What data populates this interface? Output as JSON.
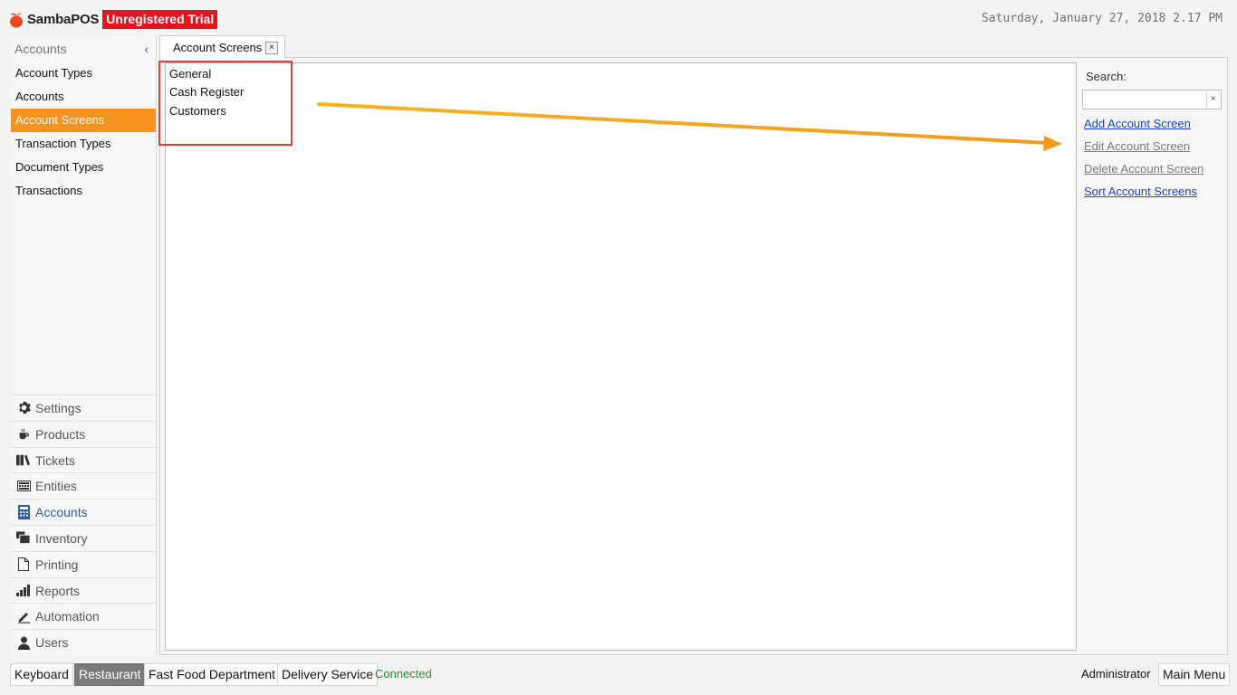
{
  "app": {
    "name": "SambaPOS",
    "trial_badge": "Unregistered Trial",
    "datetime": "Saturday, January 27, 2018 2.17 PM"
  },
  "sidebar": {
    "title": "Accounts",
    "collapse_glyph": "‹",
    "items": [
      {
        "label": "Account Types"
      },
      {
        "label": "Accounts"
      },
      {
        "label": "Account Screens"
      },
      {
        "label": "Transaction Types"
      },
      {
        "label": "Document Types"
      },
      {
        "label": "Transactions"
      }
    ],
    "active_item": "Account Screens"
  },
  "modules": [
    {
      "label": "Settings",
      "icon": "gear-icon"
    },
    {
      "label": "Products",
      "icon": "coffee-cup-icon"
    },
    {
      "label": "Tickets",
      "icon": "tickets-icon"
    },
    {
      "label": "Entities",
      "icon": "keyboard-icon"
    },
    {
      "label": "Accounts",
      "icon": "calculator-icon"
    },
    {
      "label": "Inventory",
      "icon": "inventory-icon"
    },
    {
      "label": "Printing",
      "icon": "document-icon"
    },
    {
      "label": "Reports",
      "icon": "bar-chart-icon"
    },
    {
      "label": "Automation",
      "icon": "pen-icon"
    },
    {
      "label": "Users",
      "icon": "user-icon"
    }
  ],
  "tab": {
    "label": "Account Screens",
    "close_glyph": "×"
  },
  "list": {
    "items": [
      {
        "label": "General"
      },
      {
        "label": "Cash Register"
      },
      {
        "label": "Customers"
      }
    ]
  },
  "right_panel": {
    "search_label": "Search:",
    "search_value": "",
    "clear_glyph": "×",
    "actions": [
      {
        "label": "Add Account Screen",
        "enabled": true
      },
      {
        "label": "Edit Account Screen",
        "enabled": false
      },
      {
        "label": "Delete Account Screen",
        "enabled": false
      },
      {
        "label": "Sort Account Screens",
        "enabled": true
      }
    ]
  },
  "footer": {
    "buttons": [
      {
        "label": "Keyboard"
      },
      {
        "label": "Restaurant"
      },
      {
        "label": "Fast Food Department"
      },
      {
        "label": "Delivery Service"
      }
    ],
    "selected_button": "Restaurant",
    "status": "Connected",
    "user": "Administrator",
    "main_menu": "Main Menu"
  },
  "colors": {
    "accent": "#f7931e",
    "trial_red": "#e0161c",
    "link_blue": "#1a3fd9",
    "status_green": "#2a8a2a",
    "annotation_red": "#e23b3b",
    "annotation_arrow": "#f5a623"
  }
}
